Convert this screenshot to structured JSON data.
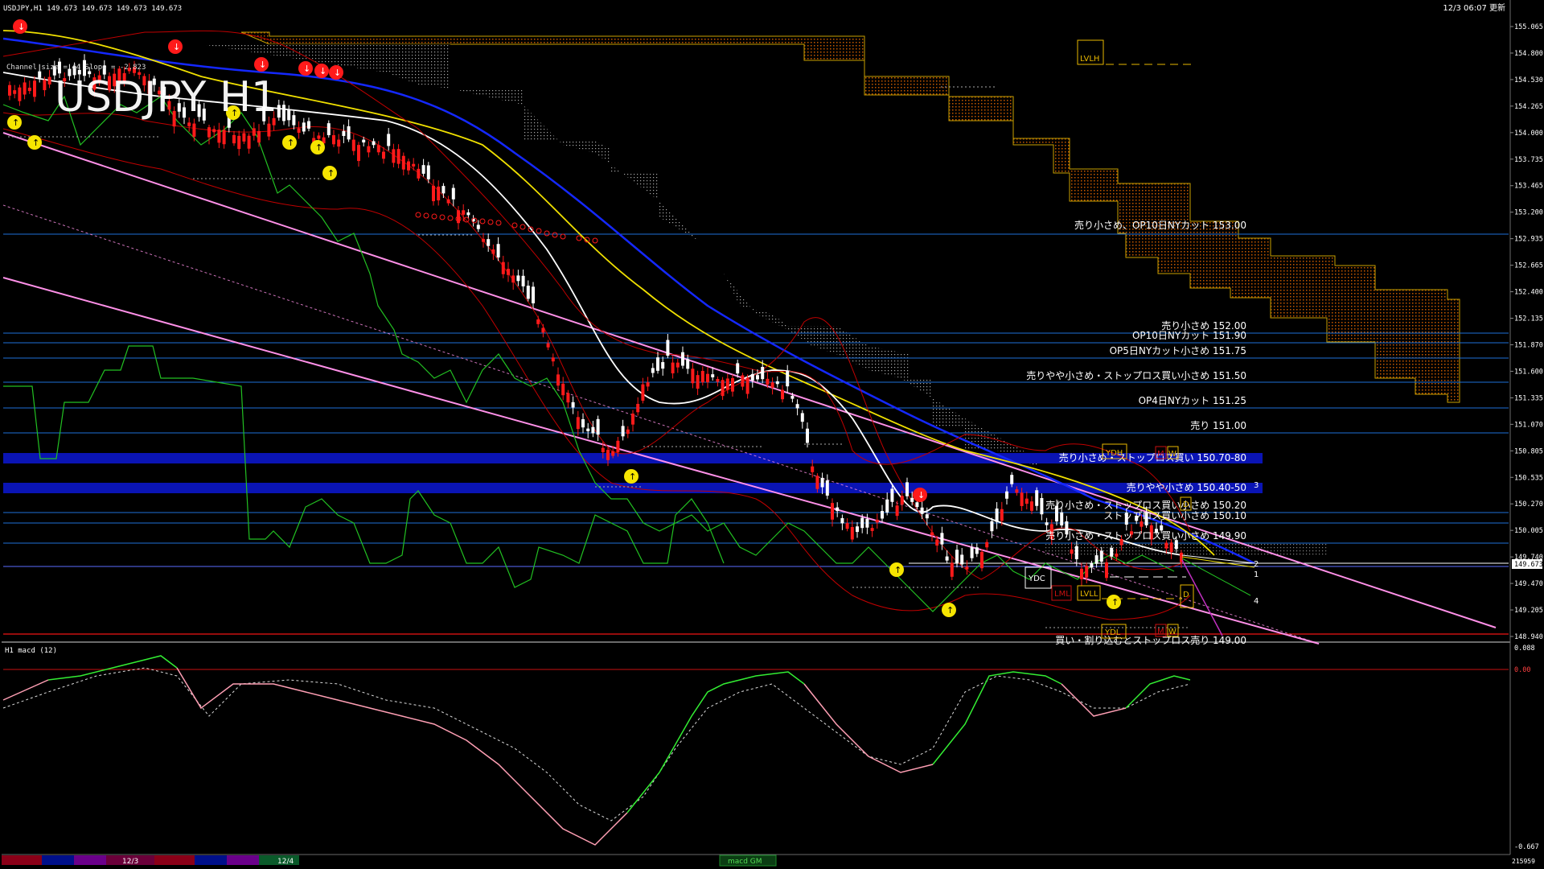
{
  "header": {
    "symbol_info": "USDJPY,H1  149.673 149.673 149.673 149.673",
    "timestamp": "12/3 06:07 更新",
    "watermark": "USDJPY H1",
    "channel_info": "Channel size = 44 Slope = -2.823"
  },
  "macd_panel": {
    "title": "H1  macd (12)",
    "scale": [
      "0.088",
      "0.00",
      "-0.667"
    ],
    "button_label": "macd GM"
  },
  "price_scale": {
    "labels": [
      "155.065",
      "154.800",
      "154.530",
      "154.265",
      "154.000",
      "153.735",
      "153.465",
      "153.200",
      "152.935",
      "152.665",
      "152.400",
      "152.135",
      "151.870",
      "151.600",
      "151.335",
      "151.070",
      "150.805",
      "150.535",
      "150.270",
      "150.005",
      "149.740",
      "149.470",
      "149.205",
      "148.940"
    ],
    "current_price": "149.673"
  },
  "levels": [
    {
      "label": "売り小さめ、OP10日NYカット 153.00"
    },
    {
      "label": "売り小さめ 152.00"
    },
    {
      "label": "OP10日NYカット 151.90"
    },
    {
      "label": "OP5日NYカット小さめ 151.75"
    },
    {
      "label": "売りやや小さめ・ストップロス買い小さめ 151.50"
    },
    {
      "label": "OP4日NYカット 151.25"
    },
    {
      "label": "売り 151.00"
    },
    {
      "label": "売り小さめ・ストップロス買い 150.70-80"
    },
    {
      "label": "売りやや小さめ 150.40-50"
    },
    {
      "label": "売り小さめ・ストップロス買い小さめ 150.20"
    },
    {
      "label": "ストップロス買い小さめ 150.10"
    },
    {
      "label": "売り小さめ・ストップロス買い小さめ 149.90"
    },
    {
      "label": "買い・割り込むとストップロス売り 149.00"
    }
  ],
  "markers": {
    "lvlh": "LVLH",
    "ydh": "YDH",
    "m1": "M",
    "w1": "W",
    "d1": "D",
    "ydc": "YDC",
    "lml": "LML",
    "lvll": "LVLL",
    "d2": "D",
    "ydl": "YDL",
    "m2": "M",
    "w2": "W"
  },
  "channel_numbers": [
    "3",
    "2",
    "1",
    "4"
  ],
  "time_axis": {
    "labels": [
      "12/3",
      "12/4"
    ],
    "volume": "215959"
  },
  "colors": {
    "background": "#000000",
    "level_line": "#1e6fd9",
    "band": "#0a14b4",
    "bull": "#ffffff",
    "bear": "#ff1a1a",
    "ma_fast": "#ffffff",
    "ma_mid": "#f0e000",
    "ma_slow": "#1428ff",
    "chikou": "#22c022",
    "cloud": "#b34a00",
    "channel": "#ff90e8",
    "bollinger": "#c00000",
    "macd_up": "#33ee33",
    "macd_down": "#ff9fb4",
    "macd_signal": "#dddddd"
  }
}
